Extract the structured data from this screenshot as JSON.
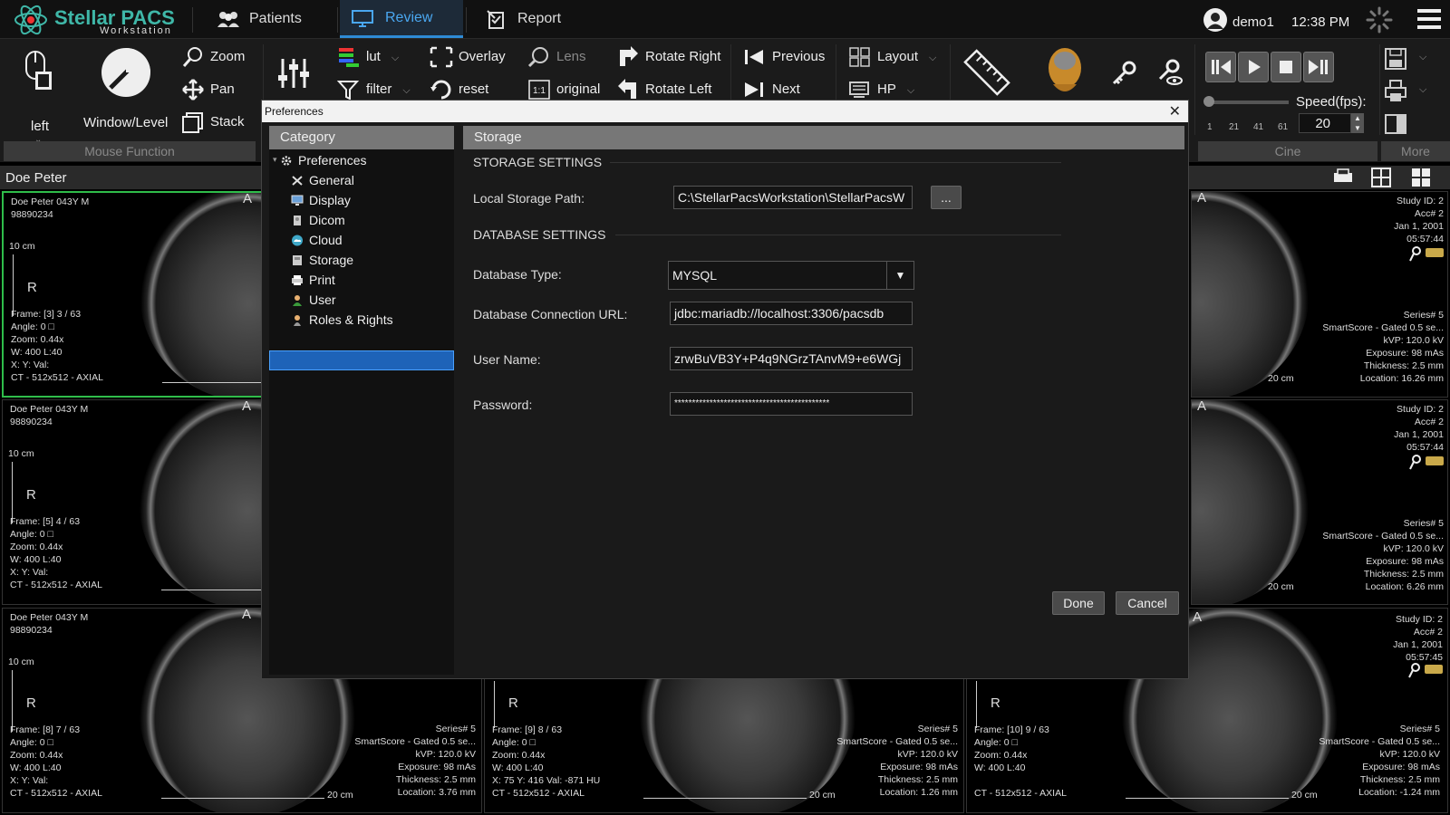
{
  "app": {
    "logo_main": "Stellar PACS",
    "logo_sub": "Workstation"
  },
  "tabs": [
    {
      "label": "Patients"
    },
    {
      "label": "Review"
    },
    {
      "label": "Report"
    }
  ],
  "user": {
    "name": "demo1",
    "time": "12:38 PM"
  },
  "toolbar": {
    "mouse": {
      "left": "left",
      "window_level": "Window/Level",
      "zoom": "Zoom",
      "pan": "Pan",
      "stack": "Stack",
      "group": "Mouse Function"
    },
    "lut": "lut",
    "filter": "filter",
    "overlay": "Overlay",
    "reset": "reset",
    "lens": "Lens",
    "original": "original",
    "rotate_right": "Rotate Right",
    "rotate_left": "Rotate Left",
    "previous": "Previous",
    "next": "Next",
    "layout": "Layout",
    "hp": "HP",
    "speed_label": "Speed(fps):",
    "speed_value": "20",
    "speed_ticks": [
      "1",
      "21",
      "41",
      "61"
    ],
    "cine_group": "Cine",
    "more_group": "More"
  },
  "patient_bar": "Doe Peter",
  "viewers": [
    {
      "name": "Doe Peter 043Y M",
      "id": "98890234",
      "scale": "10 cm",
      "frame": "Frame: [3] 3 / 63",
      "angle": "Angle: 0 □",
      "zoom": "Zoom: 0.44x",
      "wl": "W: 400 L:40",
      "xyv": "X:  Y:   Val:",
      "ct": "CT - 512x512 - AXIAL"
    },
    {
      "name": "Doe Peter 043Y M",
      "id": "98890234",
      "scale": "10 cm",
      "frame": "Frame: [5] 4 / 63",
      "angle": "Angle: 0 □",
      "zoom": "Zoom: 0.44x",
      "wl": "W: 400 L:40",
      "xyv": "X:  Y:   Val:",
      "ct": "CT - 512x512 - AXIAL"
    },
    {
      "name": "Doe Peter 043Y M",
      "id": "98890234",
      "scale": "10 cm",
      "frame": "Frame: [8] 7 / 63",
      "angle": "Angle: 0 □",
      "zoom": "Zoom: 0.44x",
      "wl": "W: 400 L:40",
      "xyv": "X:  Y:   Val:",
      "ct": "CT - 512x512 - AXIAL"
    }
  ],
  "bottom_viewers": [
    {
      "frame": "Frame: [9] 8 / 63",
      "angle": "Angle: 0 □",
      "zoom": "Zoom: 0.44x",
      "wl": "W: 400 L:40",
      "xyv": "X: 75 Y: 416 Val: -871 HU",
      "ct": "CT - 512x512 - AXIAL",
      "location": "Location: 1.26 mm"
    },
    {
      "frame": "Frame: [10] 9 / 63",
      "angle": "Angle: 0 □",
      "zoom": "Zoom: 0.44x",
      "wl": "W: 400 L:40",
      "xyv": "",
      "ct": "CT - 512x512 - AXIAL",
      "location": "Location: -1.24 mm"
    }
  ],
  "series_info": {
    "series": "Series# 5",
    "desc": "SmartScore - Gated 0.5 se...",
    "kvp": "kVP: 120.0 kV",
    "exposure": "Exposure: 98 mAs",
    "thickness": "Thickness: 2.5 mm",
    "scale": "20 cm",
    "loc_bottom_left": "Location: 3.76 mm"
  },
  "right_viewers": [
    {
      "study": "Study ID: 2",
      "acc": "Acc# 2",
      "date": "Jan 1, 2001",
      "time": "05:57:44",
      "location": "Location: 16.26 mm"
    },
    {
      "study": "Study ID: 2",
      "acc": "Acc# 2",
      "date": "Jan 1, 2001",
      "time": "05:57:44",
      "location": "Location: 6.26 mm"
    },
    {
      "study": "Study ID: 2",
      "acc": "Acc# 2",
      "date": "Jan 1, 2001",
      "time": "05:57:45",
      "location": "Location: -1.24 mm"
    }
  ],
  "orient": {
    "a": "A",
    "r": "R"
  },
  "dialog": {
    "title": "Preferences",
    "category_header": "Category",
    "categories": [
      {
        "label": "Preferences"
      },
      {
        "label": "General"
      },
      {
        "label": "Display"
      },
      {
        "label": "Dicom"
      },
      {
        "label": "Cloud"
      },
      {
        "label": "Storage"
      },
      {
        "label": "Print"
      },
      {
        "label": "User"
      },
      {
        "label": "Roles & Rights"
      }
    ],
    "panel_header": "Storage",
    "storage_settings": "STORAGE SETTINGS",
    "local_path_label": "Local Storage Path:",
    "local_path_value": "C:\\StellarPacsWorkstation\\StellarPacsW",
    "browse": "...",
    "database_settings": "DATABASE SETTINGS",
    "db_type_label": "Database Type:",
    "db_type_value": "MYSQL",
    "db_url_label": "Database Connection URL:",
    "db_url_value": "jdbc:mariadb://localhost:3306/pacsdb",
    "username_label": "User Name:",
    "username_value": "zrwBuVB3Y+P4q9NGrzTAnvM9+e6WGj",
    "password_label": "Password:",
    "password_value": "********************************************",
    "done": "Done",
    "cancel": "Cancel"
  },
  "colors": {
    "accent": "#2e8bd6",
    "selected_viewer": "#2fbd4a",
    "category_selected": "#1e63b8"
  }
}
